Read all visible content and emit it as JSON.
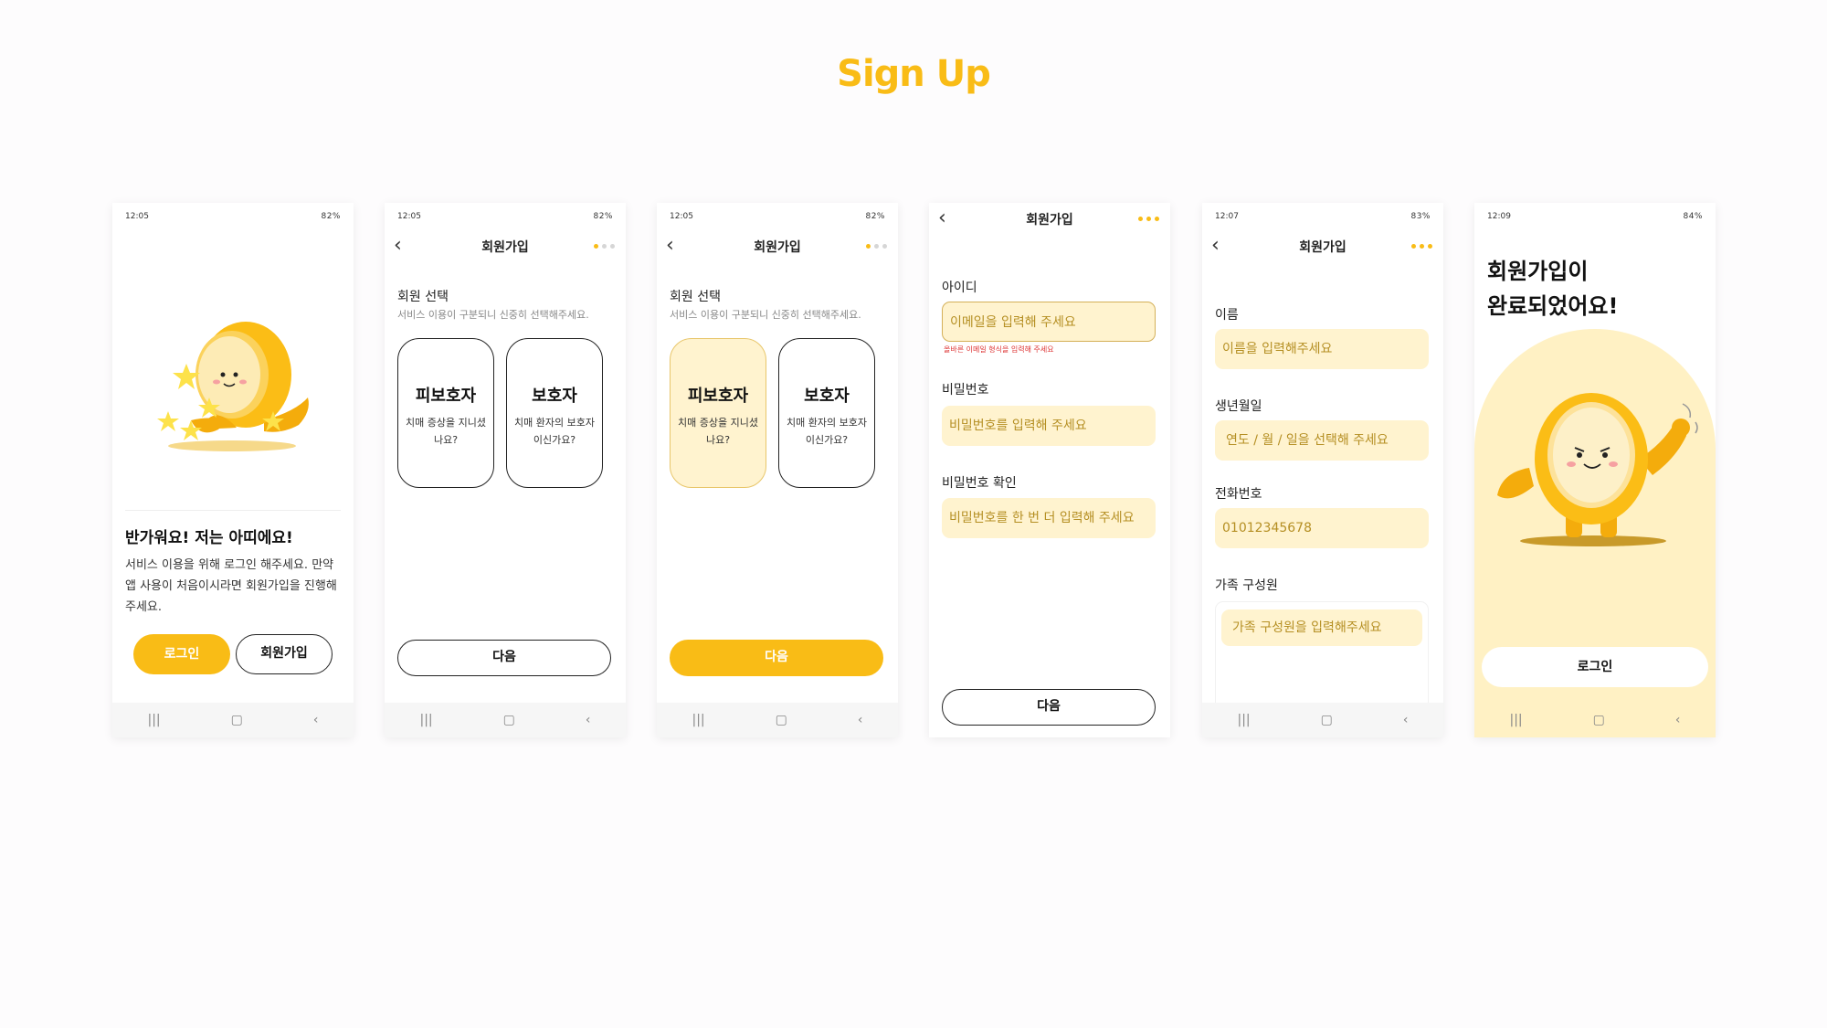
{
  "title": "Sign Up",
  "colors": {
    "accent": "#f9bc16",
    "accent_soft": "#fff3cf",
    "error": "#dd3333"
  },
  "nav": {
    "recent": "|||",
    "home": "▢",
    "back": "‹"
  },
  "screens": {
    "welcome": {
      "status_time": "12:05",
      "status_right": "82%",
      "heading": "반가워요! 저는 아띠에요!",
      "desc": "서비스 이용을 위해 로그인 해주세요. 만약 앱 사용이 처음이시라면 회원가입을 진행해주세요.",
      "login_label": "로그인",
      "signup_label": "회원가입"
    },
    "type_select": {
      "status_time": "12:05",
      "status_right": "82%",
      "appbar_title": "회원가입",
      "section_label": "회원 선택",
      "section_sub": "서비스 이용이 구분되니 신중히 선택해주세요.",
      "option1_title": "피보호자",
      "option1_desc": "치매 증상을 지니셨나요?",
      "option2_title": "보호자",
      "option2_desc": "치매 환자의 보호자이신가요?",
      "next_label": "다음"
    },
    "type_selected": {
      "status_time": "12:05",
      "status_right": "82%",
      "appbar_title": "회원가입",
      "section_label": "회원 선택",
      "section_sub": "서비스 이용이 구분되니 신중히 선택해주세요.",
      "option1_title": "피보호자",
      "option1_desc": "치매 증상을 지니셨나요?",
      "option2_title": "보호자",
      "option2_desc": "치매 환자의 보호자이신가요?",
      "next_label": "다음"
    },
    "account": {
      "appbar_title": "회원가입",
      "id_label": "아이디",
      "id_placeholder": "이메일을 입력해 주세요",
      "id_error": "올바른 이메일 형식을 입력해 주세요",
      "pw_label": "비밀번호",
      "pw_placeholder": "비밀번호를 입력해 주세요",
      "pw2_label": "비밀번호 확인",
      "pw2_placeholder": "비밀번호를 한 번 더 입력해 주세요",
      "next_label": "다음"
    },
    "profile": {
      "status_time": "12:07",
      "status_right": "83%",
      "appbar_title": "회원가입",
      "name_label": "이름",
      "name_placeholder": "이름을 입력해주세요",
      "birth_label": "생년월일",
      "birth_placeholder": "연도 / 월 / 일을 선택해 주세요",
      "phone_label": "전화번호",
      "phone_value": "01012345678",
      "family_label": "가족 구성원",
      "family_placeholder": "가족 구성원을 입력해주세요"
    },
    "complete": {
      "status_time": "12:09",
      "status_right": "84%",
      "title_line1": "회원가입이",
      "title_line2": "완료되었어요!",
      "login_label": "로그인"
    }
  }
}
